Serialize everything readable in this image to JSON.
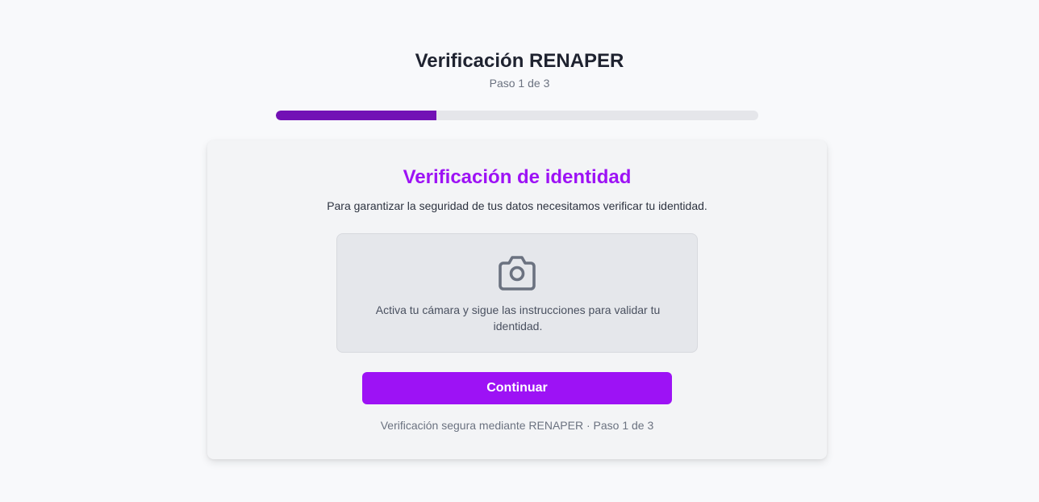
{
  "header": {
    "title": "Verificación RENAPER",
    "step": "Paso 1 de 3"
  },
  "progress": {
    "fraction": 0.3333,
    "fill_color": "#7211b5",
    "track_color": "#e5e6ea"
  },
  "card": {
    "title": "Verificación de identidad",
    "description": "Para garantizar la seguridad de tus datos necesitamos verificar tu identidad.",
    "camera": {
      "icon": "camera-icon",
      "text": "Activa tu cámara y sigue las instrucciones para validar tu identidad."
    },
    "continue_label": "Continuar",
    "footer": "Verificación segura mediante RENAPER · Paso 1 de 3"
  },
  "colors": {
    "accent": "#9d12f5",
    "background": "#f8f9fb"
  }
}
